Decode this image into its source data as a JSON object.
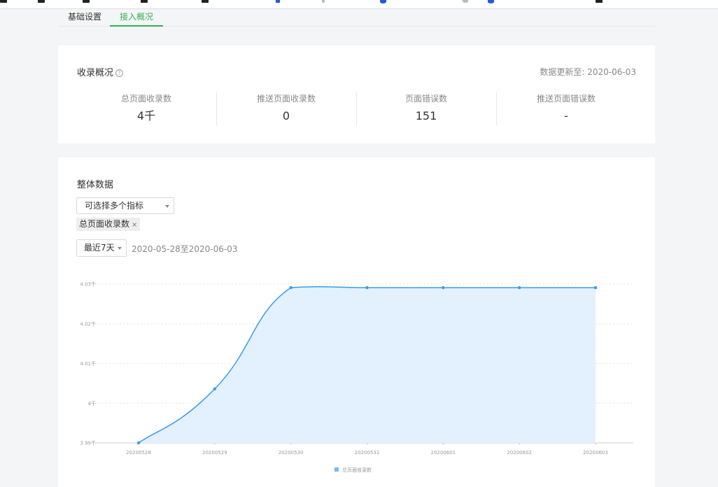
{
  "tabs": [
    {
      "label": "基础设置",
      "active": false
    },
    {
      "label": "接入概况",
      "active": true
    }
  ],
  "overview": {
    "title": "收录概况",
    "help_icon": "question-circle-icon",
    "updated": "数据更新至: 2020-06-03",
    "stats": [
      {
        "label": "总页面收录数",
        "value": "4千"
      },
      {
        "label": "推送页面收录数",
        "value": "0"
      },
      {
        "label": "页面错误数",
        "value": "151"
      },
      {
        "label": "推送页面错误数",
        "value": "-"
      }
    ]
  },
  "overall": {
    "title": "整体数据",
    "metric_select": {
      "placeholder": "可选择多个指标"
    },
    "selected_tags": [
      {
        "label": "总页面收录数",
        "remove": "×"
      }
    ],
    "range_select": {
      "value": "最近7天"
    },
    "date_range": "2020-05-28至2020-06-03"
  },
  "colors": {
    "accent": "#2fb254",
    "line": "#3c9be8",
    "area": "#e3f0fd"
  },
  "chart_data": {
    "type": "area",
    "x": [
      "20200528",
      "20200529",
      "20200530",
      "20200531",
      "20200601",
      "20200602",
      "20200603"
    ],
    "series": [
      {
        "name": "总页面收录数",
        "values": [
          3.99,
          4.0036,
          4.0291,
          4.0291,
          4.0291,
          4.0291,
          4.0291
        ]
      }
    ],
    "ylim": [
      3.99,
      4.03
    ],
    "yticks": [
      3.99,
      4.0,
      4.01,
      4.02,
      4.03
    ],
    "ytick_labels": [
      "3.99千",
      "4千",
      "4.01千",
      "4.02千",
      "4.03千"
    ],
    "grid": true,
    "legend": "bottom-center",
    "smooth": true
  }
}
